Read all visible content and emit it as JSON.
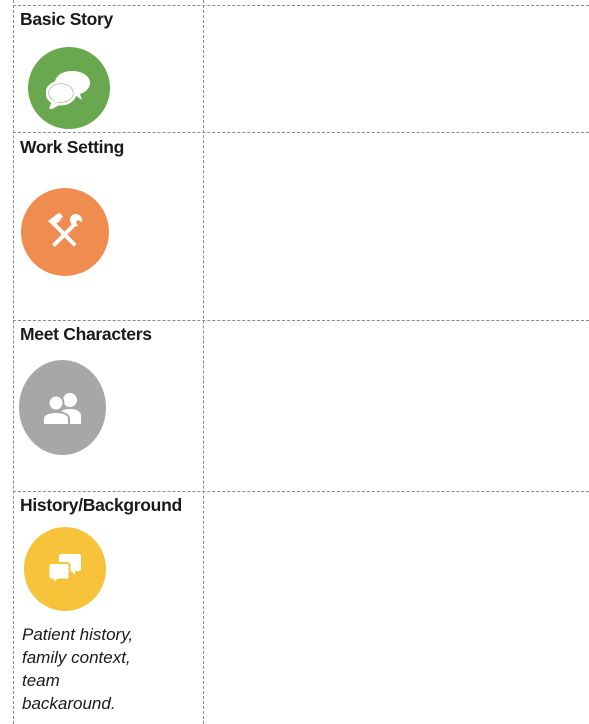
{
  "rows": [
    {
      "title": "Basic Story",
      "icon": "speech-bubbles-icon",
      "color": "#6aa84f"
    },
    {
      "title": "Work Setting",
      "icon": "hammer-wrench-icon",
      "color": "#ef8c50"
    },
    {
      "title": "Meet Characters",
      "icon": "people-icon",
      "color": "#a7a7a7"
    },
    {
      "title": "History/Background",
      "icon": "chat-icon",
      "color": "#f7c33b",
      "note": [
        "Patient history,",
        "family context,",
        "team",
        "backaround."
      ]
    }
  ]
}
